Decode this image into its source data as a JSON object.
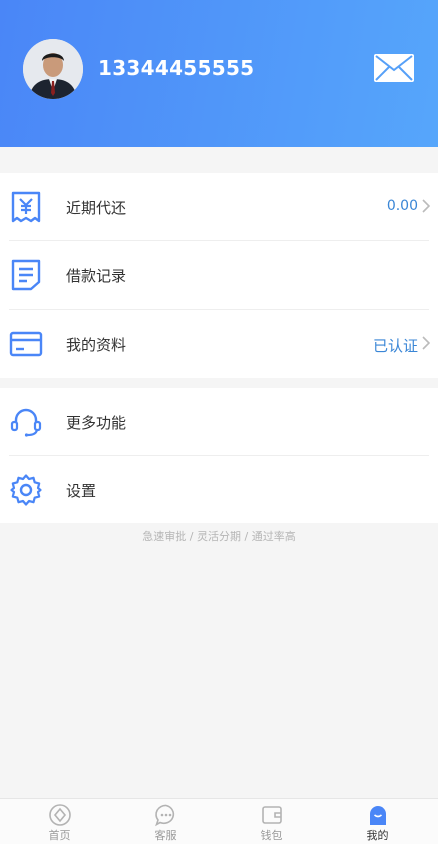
{
  "header": {
    "phone": "13344455555"
  },
  "menu_top": [
    {
      "label": "近期代还",
      "value": "0.00",
      "icon": "yuan-receipt-icon"
    },
    {
      "label": "借款记录",
      "value": "",
      "icon": "document-icon"
    },
    {
      "label": "我的资料",
      "value": "已认证",
      "icon": "card-icon"
    }
  ],
  "menu_bottom": [
    {
      "label": "更多功能",
      "icon": "headset-icon"
    },
    {
      "label": "设置",
      "icon": "gear-icon"
    }
  ],
  "slogan": "急速审批 / 灵活分期 / 通过率高",
  "tabs": [
    {
      "label": "首页",
      "icon": "home-icon",
      "active": false
    },
    {
      "label": "客服",
      "icon": "chat-icon",
      "active": false
    },
    {
      "label": "钱包",
      "icon": "wallet-icon",
      "active": false
    },
    {
      "label": "我的",
      "icon": "user-icon",
      "active": true
    }
  ],
  "colors": {
    "header_start": "#4a86f7",
    "header_end": "#56a6fb",
    "accent": "#3a86d6",
    "icon_blue": "#4a86f7"
  }
}
